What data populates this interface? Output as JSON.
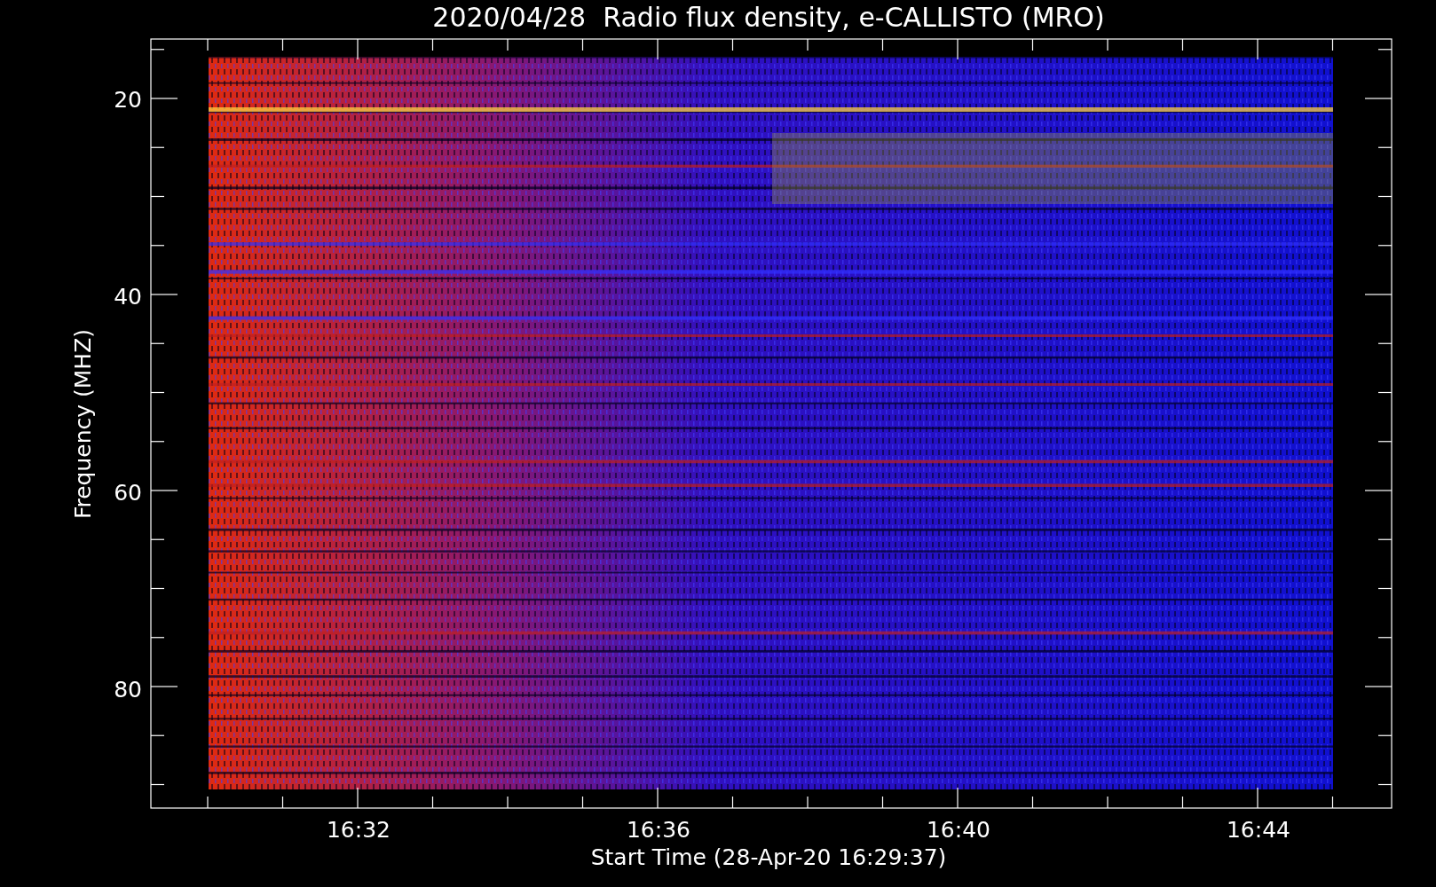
{
  "plot": {
    "title": "2020/04/28  Radio flux density, e-CALLISTO (MRO)",
    "ylabel": "Frequency (MHZ)",
    "xlabel": "Start Time (28-Apr-20 16:29:37)",
    "yticks": [
      "20",
      "40",
      "60",
      "80"
    ],
    "xticks": [
      "16:32",
      "16:36",
      "16:40",
      "16:44"
    ]
  }
}
